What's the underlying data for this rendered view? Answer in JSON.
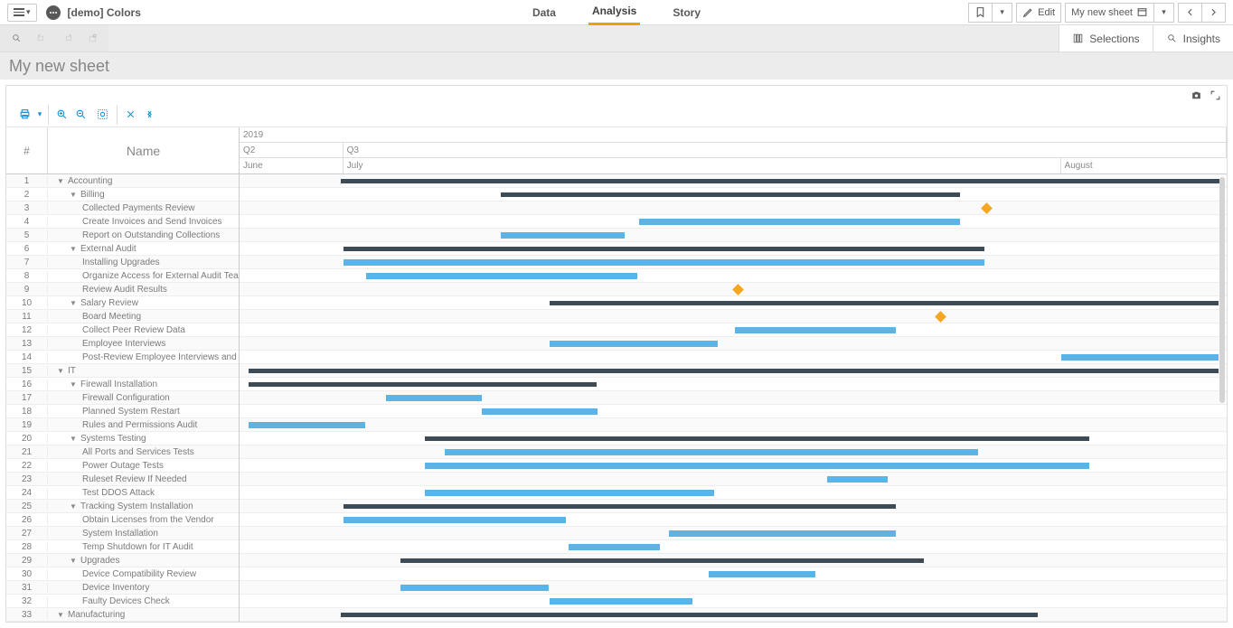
{
  "app": {
    "title": "[demo] Colors"
  },
  "tabs": {
    "data": "Data",
    "analysis": "Analysis",
    "story": "Story"
  },
  "top_right": {
    "edit": "Edit",
    "sheet_name": "My new sheet"
  },
  "sel_panel": {
    "selections": "Selections",
    "insights": "Insights"
  },
  "sheet_title": "My new sheet",
  "columns": {
    "num": "#",
    "name": "Name"
  },
  "timeline": {
    "year": "2019",
    "q2": "Q2",
    "q3": "Q3",
    "june": "June",
    "july": "July",
    "august": "August"
  },
  "rows": [
    {
      "n": "1",
      "name": "Accounting",
      "indent": 0,
      "exp": true
    },
    {
      "n": "2",
      "name": "Billing",
      "indent": 1,
      "exp": true
    },
    {
      "n": "3",
      "name": "Collected Payments Review",
      "indent": 2
    },
    {
      "n": "4",
      "name": "Create Invoices and Send Invoices",
      "indent": 2
    },
    {
      "n": "5",
      "name": "Report on Outstanding Collections",
      "indent": 2
    },
    {
      "n": "6",
      "name": "External Audit",
      "indent": 1,
      "exp": true
    },
    {
      "n": "7",
      "name": "Installing Upgrades",
      "indent": 2
    },
    {
      "n": "8",
      "name": "Organize Access for External Audit Team",
      "indent": 2
    },
    {
      "n": "9",
      "name": "Review Audit Results",
      "indent": 2
    },
    {
      "n": "10",
      "name": "Salary Review",
      "indent": 1,
      "exp": true
    },
    {
      "n": "11",
      "name": "Board Meeting",
      "indent": 2
    },
    {
      "n": "12",
      "name": "Collect Peer Review Data",
      "indent": 2
    },
    {
      "n": "13",
      "name": "Employee Interviews",
      "indent": 2
    },
    {
      "n": "14",
      "name": "Post-Review Employee Interviews and Notifications",
      "indent": 2
    },
    {
      "n": "15",
      "name": "IT",
      "indent": 0,
      "exp": true
    },
    {
      "n": "16",
      "name": "Firewall Installation",
      "indent": 1,
      "exp": true
    },
    {
      "n": "17",
      "name": "Firewall Configuration",
      "indent": 2
    },
    {
      "n": "18",
      "name": "Planned System Restart",
      "indent": 2
    },
    {
      "n": "19",
      "name": "Rules and Permissions Audit",
      "indent": 2
    },
    {
      "n": "20",
      "name": "Systems Testing",
      "indent": 1,
      "exp": true
    },
    {
      "n": "21",
      "name": "All Ports and Services Tests",
      "indent": 2
    },
    {
      "n": "22",
      "name": "Power Outage Tests",
      "indent": 2
    },
    {
      "n": "23",
      "name": "Ruleset Review If Needed",
      "indent": 2
    },
    {
      "n": "24",
      "name": "Test DDOS Attack",
      "indent": 2
    },
    {
      "n": "25",
      "name": "Tracking System Installation",
      "indent": 1,
      "exp": true
    },
    {
      "n": "26",
      "name": "Obtain Licenses from the Vendor",
      "indent": 2
    },
    {
      "n": "27",
      "name": "System Installation",
      "indent": 2
    },
    {
      "n": "28",
      "name": "Temp Shutdown for IT Audit",
      "indent": 2
    },
    {
      "n": "29",
      "name": "Upgrades",
      "indent": 1,
      "exp": true
    },
    {
      "n": "30",
      "name": "Device Compatibility Review",
      "indent": 2
    },
    {
      "n": "31",
      "name": "Device Inventory",
      "indent": 2
    },
    {
      "n": "32",
      "name": "Faulty Devices Check",
      "indent": 2
    },
    {
      "n": "33",
      "name": "Manufacturing",
      "indent": 0,
      "exp": true
    }
  ],
  "chart_data": {
    "type": "gantt",
    "time_axis": {
      "year": "2019",
      "quarters": [
        "Q2",
        "Q3"
      ],
      "months": [
        "June",
        "July",
        "August"
      ]
    },
    "bars": [
      {
        "row": 1,
        "type": "summary",
        "start_pct": 10.3,
        "width_pct": 89.0
      },
      {
        "row": 2,
        "type": "summary",
        "start_pct": 26.5,
        "width_pct": 46.5
      },
      {
        "row": 3,
        "type": "milestone",
        "pos_pct": 75.6
      },
      {
        "row": 4,
        "type": "task",
        "start_pct": 40.5,
        "width_pct": 32.5
      },
      {
        "row": 5,
        "type": "task",
        "start_pct": 26.5,
        "width_pct": 12.5
      },
      {
        "row": 6,
        "type": "summary",
        "start_pct": 10.5,
        "width_pct": 65.0
      },
      {
        "row": 7,
        "type": "task",
        "start_pct": 10.5,
        "width_pct": 65.0
      },
      {
        "row": 8,
        "type": "task",
        "start_pct": 12.8,
        "width_pct": 27.5
      },
      {
        "row": 9,
        "type": "milestone",
        "pos_pct": 50.5
      },
      {
        "row": 10,
        "type": "summary",
        "start_pct": 31.4,
        "width_pct": 67.8
      },
      {
        "row": 11,
        "type": "milestone",
        "pos_pct": 71.0
      },
      {
        "row": 12,
        "type": "task",
        "start_pct": 50.2,
        "width_pct": 16.3
      },
      {
        "row": 13,
        "type": "task",
        "start_pct": 31.4,
        "width_pct": 17.0
      },
      {
        "row": 14,
        "type": "task",
        "start_pct": 83.2,
        "width_pct": 16.0
      },
      {
        "row": 15,
        "type": "summary",
        "start_pct": 0.9,
        "width_pct": 98.3
      },
      {
        "row": 16,
        "type": "summary",
        "start_pct": 0.9,
        "width_pct": 35.3
      },
      {
        "row": 17,
        "type": "task",
        "start_pct": 14.8,
        "width_pct": 9.7
      },
      {
        "row": 18,
        "type": "task",
        "start_pct": 24.5,
        "width_pct": 11.8
      },
      {
        "row": 19,
        "type": "task",
        "start_pct": 0.9,
        "width_pct": 11.8
      },
      {
        "row": 20,
        "type": "summary",
        "start_pct": 18.8,
        "width_pct": 67.3
      },
      {
        "row": 21,
        "type": "task",
        "start_pct": 20.8,
        "width_pct": 54.0
      },
      {
        "row": 22,
        "type": "task",
        "start_pct": 18.8,
        "width_pct": 67.3
      },
      {
        "row": 23,
        "type": "task",
        "start_pct": 59.5,
        "width_pct": 6.2
      },
      {
        "row": 24,
        "type": "task",
        "start_pct": 18.8,
        "width_pct": 29.3
      },
      {
        "row": 25,
        "type": "summary",
        "start_pct": 10.5,
        "width_pct": 56.0
      },
      {
        "row": 26,
        "type": "task",
        "start_pct": 10.5,
        "width_pct": 22.6
      },
      {
        "row": 27,
        "type": "task",
        "start_pct": 43.5,
        "width_pct": 23.0
      },
      {
        "row": 28,
        "type": "task",
        "start_pct": 33.3,
        "width_pct": 9.3
      },
      {
        "row": 29,
        "type": "summary",
        "start_pct": 16.3,
        "width_pct": 53.0
      },
      {
        "row": 30,
        "type": "task",
        "start_pct": 47.5,
        "width_pct": 10.8
      },
      {
        "row": 31,
        "type": "task",
        "start_pct": 16.3,
        "width_pct": 15.0
      },
      {
        "row": 32,
        "type": "task",
        "start_pct": 31.4,
        "width_pct": 14.5
      },
      {
        "row": 33,
        "type": "summary",
        "start_pct": 10.3,
        "width_pct": 70.6
      }
    ],
    "colors": {
      "summary": "#3d4b56",
      "task": "#5cb3e6",
      "milestone": "#f5a623"
    }
  }
}
